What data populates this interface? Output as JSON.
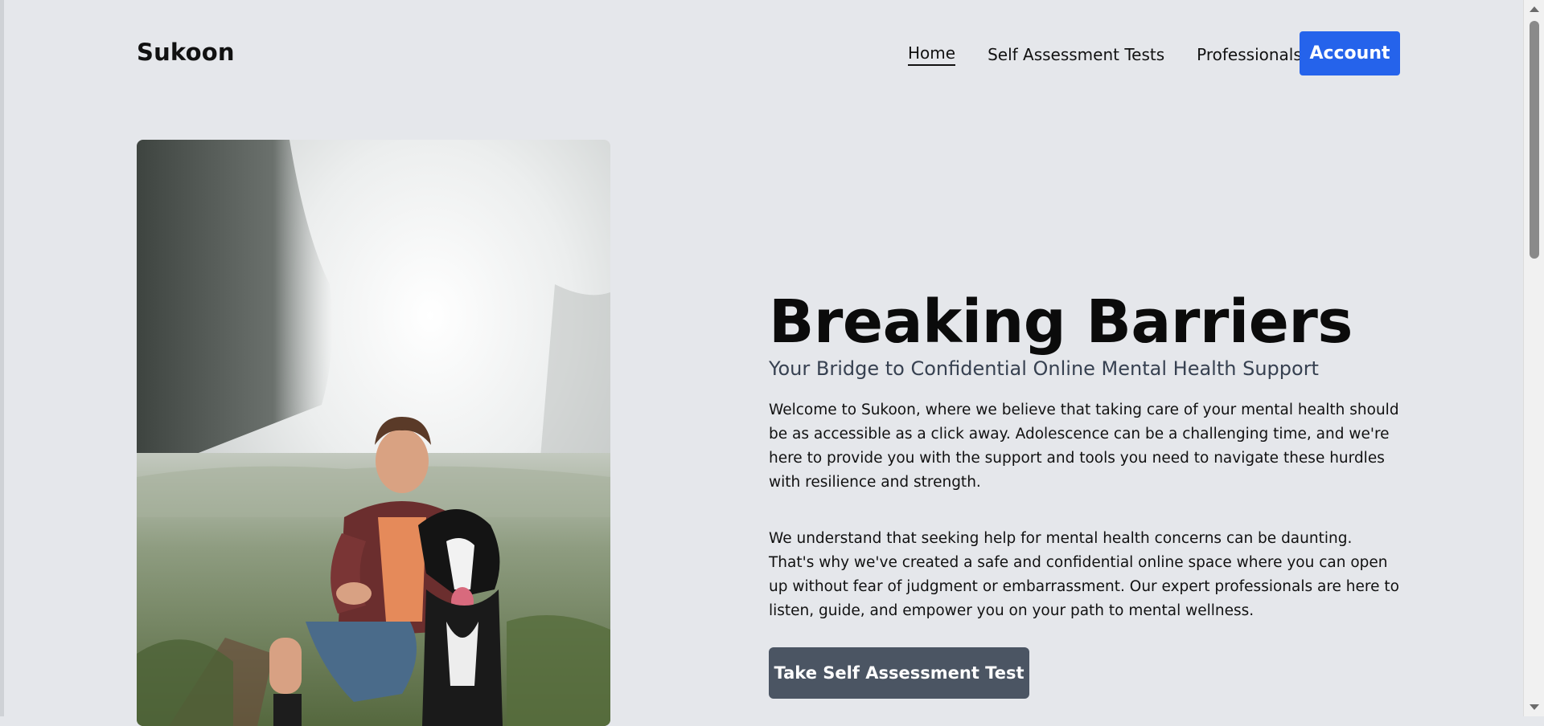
{
  "header": {
    "brand": "Sukoon",
    "nav": [
      {
        "label": "Home",
        "active": true
      },
      {
        "label": "Self Assessment Tests",
        "active": false
      },
      {
        "label": "Professionals",
        "active": false
      }
    ],
    "account_label": "Account"
  },
  "hero": {
    "title": "Breaking Barriers",
    "subtitle": "Your Bridge to Confidential Online Mental Health Support",
    "paragraph1": "Welcome to Sukoon, where we believe that taking care of your mental health should be as accessible as a click away. Adolescence can be a challenging time, and we're here to provide you with the support and tools you need to navigate these hurdles with resilience and strength.",
    "paragraph2": "We understand that seeking help for mental health concerns can be daunting. That's why we've created a safe and confidential online space where you can open up without fear of judgment or embarrassment. Our expert professionals are here to listen, guide, and empower you on your path to mental wellness.",
    "cta_label": "Take Self Assessment Test"
  },
  "colors": {
    "background": "#e5e7eb",
    "accent": "#2563eb",
    "cta": "#4b5563"
  }
}
